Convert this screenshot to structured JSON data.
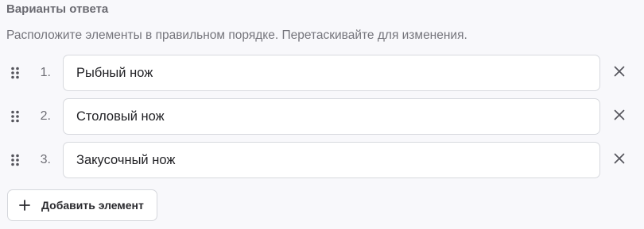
{
  "answers_section": {
    "title": "Варианты ответа",
    "instructions": "Расположите элементы в правильном порядке. Перетаскивайте для изменения.",
    "items": [
      {
        "number": "1.",
        "value": "Рыбный нож"
      },
      {
        "number": "2.",
        "value": "Столовый нож"
      },
      {
        "number": "3.",
        "value": "Закусочный нож"
      }
    ],
    "add_button_label": "Добавить элемент"
  },
  "icons": {
    "drag": "drag-handle-icon",
    "remove": "close-icon",
    "add": "plus-icon"
  },
  "colors": {
    "background": "#f8f8fb",
    "input_border": "#d7d9de",
    "muted_text": "#6b6b72",
    "text": "#222226"
  }
}
